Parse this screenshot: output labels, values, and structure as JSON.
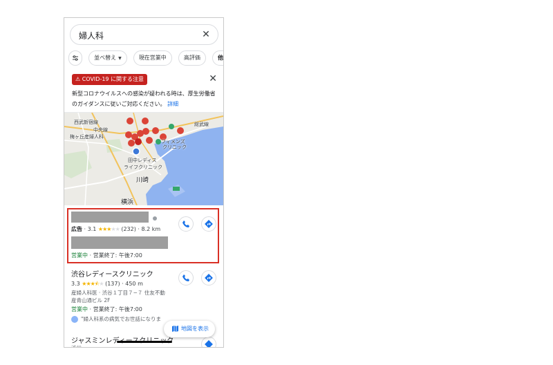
{
  "search": {
    "query": "婦人科"
  },
  "chips": [
    "並べ替え",
    "現在営業中",
    "高評価",
    "他のフィ"
  ],
  "notice": {
    "badge": "COVID-19 に関する注意",
    "text": "新型コロナウイルスへの感染が疑われる時は、厚生労働省のガイダンスに従いご対応ください。",
    "link": "詳細"
  },
  "map": {
    "labels": [
      "西武新宿線",
      "中央線",
      "梅ヶ丘産婦人科",
      "田中レディス",
      "ライフクリニック",
      "川崎",
      "横浜",
      "フィメンズ",
      "クリニック",
      "総武線"
    ]
  },
  "results": [
    {
      "ad_label": "広告",
      "rating": "3.1",
      "stars": 3,
      "reviews": "(232)",
      "distance": "8.2 km",
      "status_open": "営業中",
      "status_close": "営業終了: 午後7:00"
    },
    {
      "name": "渋谷レディースクリニック",
      "rating": "3.3",
      "stars": 3.5,
      "reviews": "(137)",
      "distance": "450 m",
      "address_line1": "産婦人科医 · 渋谷１丁目７−７ 住友不動",
      "address_line2": "産青山通ビル 2F",
      "status_open": "営業中",
      "status_close": "営業終了: 午後7:00",
      "review_snippet": "\"婦人科系の病気でお世話になりま"
    },
    {
      "name": "ジャスミンレディースクリニック",
      "address_snippet": "渋谷"
    }
  ],
  "show_map_label": "地図を表示",
  "colors": {
    "accent": "#1a73e8",
    "open": "#188038",
    "alert": "#c5221f",
    "highlight": "#d93025",
    "star": "#f4b400"
  }
}
